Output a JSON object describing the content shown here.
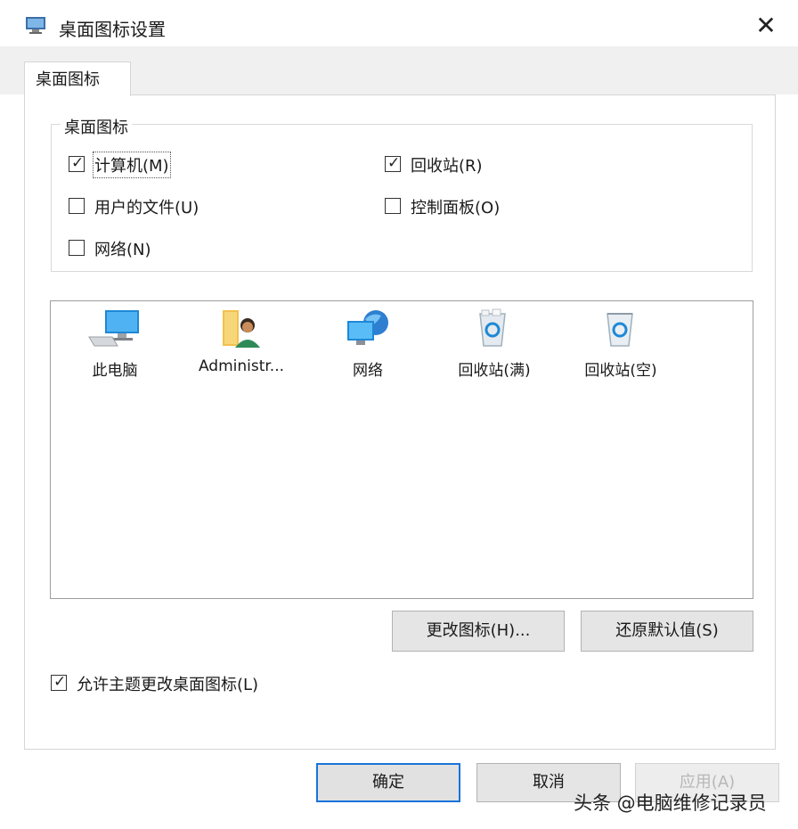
{
  "window": {
    "title": "桌面图标设置",
    "close_label": "✕"
  },
  "tab": {
    "label": "桌面图标"
  },
  "group": {
    "legend": "桌面图标",
    "checkboxes": [
      {
        "label": "计算机(M)",
        "checked": true
      },
      {
        "label": "回收站(R)",
        "checked": true
      },
      {
        "label": "用户的文件(U)",
        "checked": false
      },
      {
        "label": "控制面板(O)",
        "checked": false
      },
      {
        "label": "网络(N)",
        "checked": false
      }
    ]
  },
  "icons": [
    {
      "label": "此电脑",
      "icon": "computer-icon"
    },
    {
      "label": "Administr...",
      "icon": "user-folder-icon"
    },
    {
      "label": "网络",
      "icon": "network-icon"
    },
    {
      "label": "回收站(满)",
      "icon": "recycle-bin-full-icon"
    },
    {
      "label": "回收站(空)",
      "icon": "recycle-bin-empty-icon"
    }
  ],
  "buttons": {
    "change_icon": "更改图标(H)...",
    "restore_default": "还原默认值(S)",
    "ok": "确定",
    "cancel": "取消",
    "apply": "应用(A)"
  },
  "allow_themes": {
    "label": "允许主题更改桌面图标(L)",
    "checked": true
  },
  "watermark": "头条 @电脑维修记录员",
  "colors": {
    "focus_border": "#1a73d9",
    "disabled_text": "#b7b7b7"
  }
}
